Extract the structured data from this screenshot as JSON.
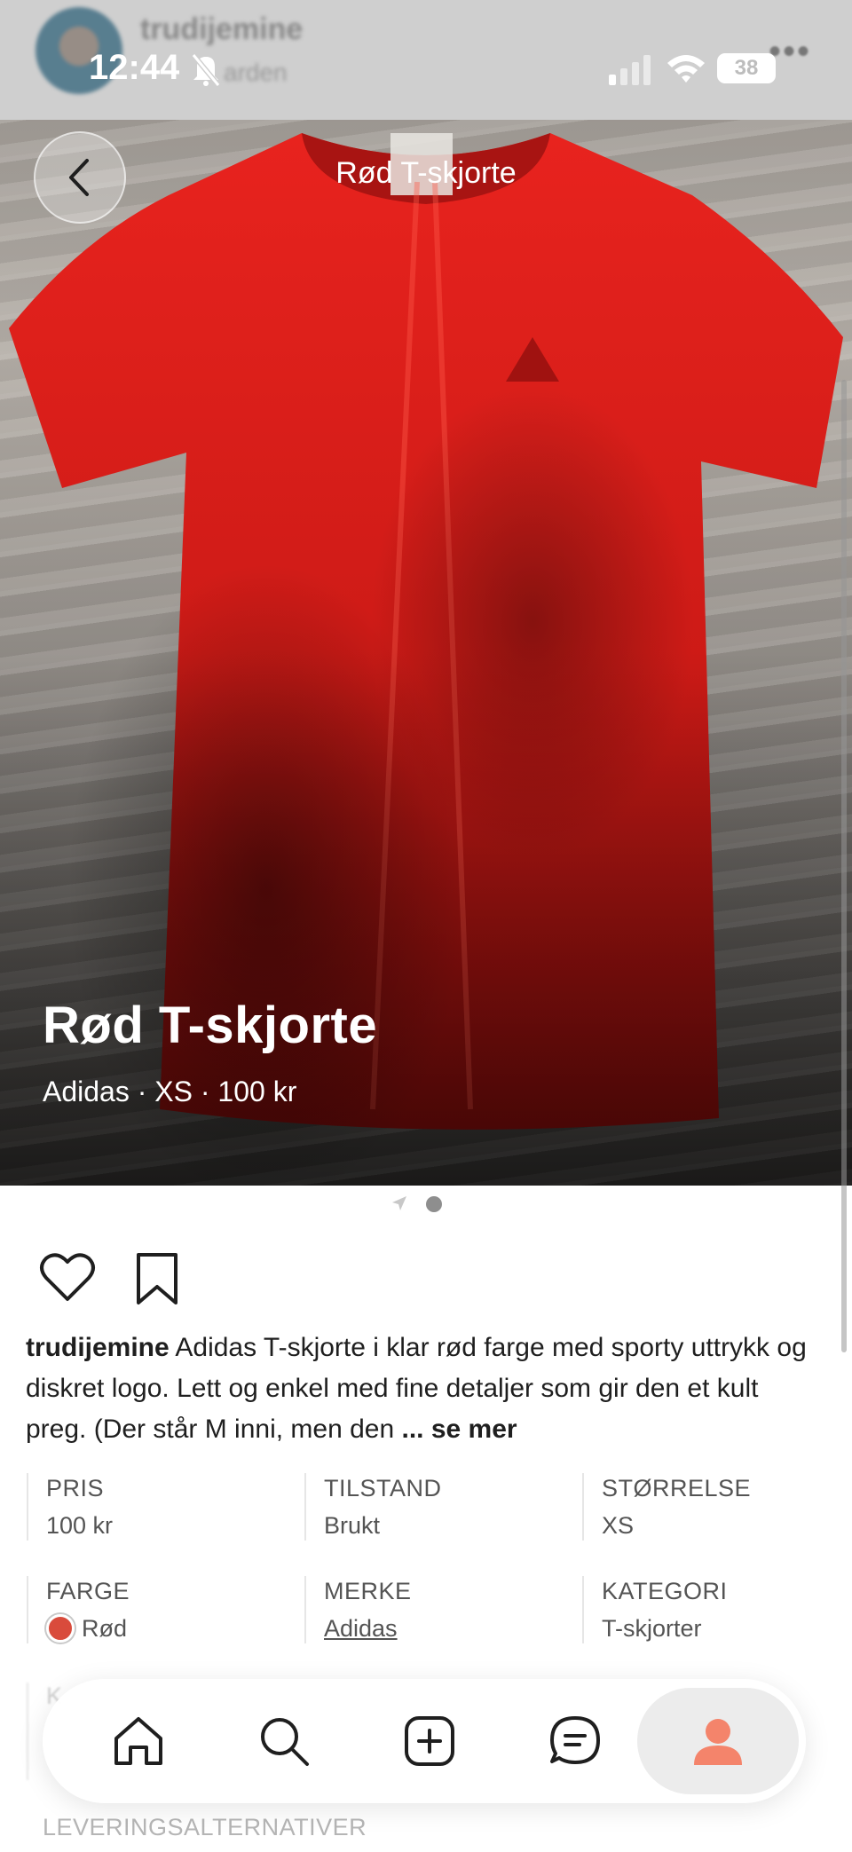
{
  "status_bar": {
    "time": "12:44",
    "battery": "38"
  },
  "header_behind": {
    "username": "trudijemine",
    "subtitle": "arden"
  },
  "nav": {
    "title": "Rød T-skjorte"
  },
  "hero": {
    "title": "Rød T-skjorte",
    "subtitle": "Adidas · XS · 100 kr"
  },
  "carousel": {
    "current": 2,
    "total": 2
  },
  "description": {
    "username": "trudijemine",
    "text": "Adidas T-skjorte i klar rød farge med sporty uttrykk og diskret logo. Lett og enkel med fine detaljer som gir den et kult preg. (Der står M inni, men den",
    "more": "... se mer"
  },
  "attributes": [
    {
      "label": "PRIS",
      "value": "100 kr"
    },
    {
      "label": "TILSTAND",
      "value": "Brukt"
    },
    {
      "label": "STØRRELSE",
      "value": "XS"
    },
    {
      "label": "FARGE",
      "value": "Rød",
      "swatch": "#d94b3c"
    },
    {
      "label": "MERKE",
      "value": "Adidas"
    },
    {
      "label": "KATEGORI",
      "value": "T-skjorter"
    }
  ],
  "delivery_label": "LEVERINGSALTERNATIVER",
  "tabbar": {
    "items": [
      "home-icon",
      "search-icon",
      "add-icon",
      "messages-icon",
      "profile-icon"
    ],
    "active": "profile-icon",
    "accent": "#f4846b"
  }
}
